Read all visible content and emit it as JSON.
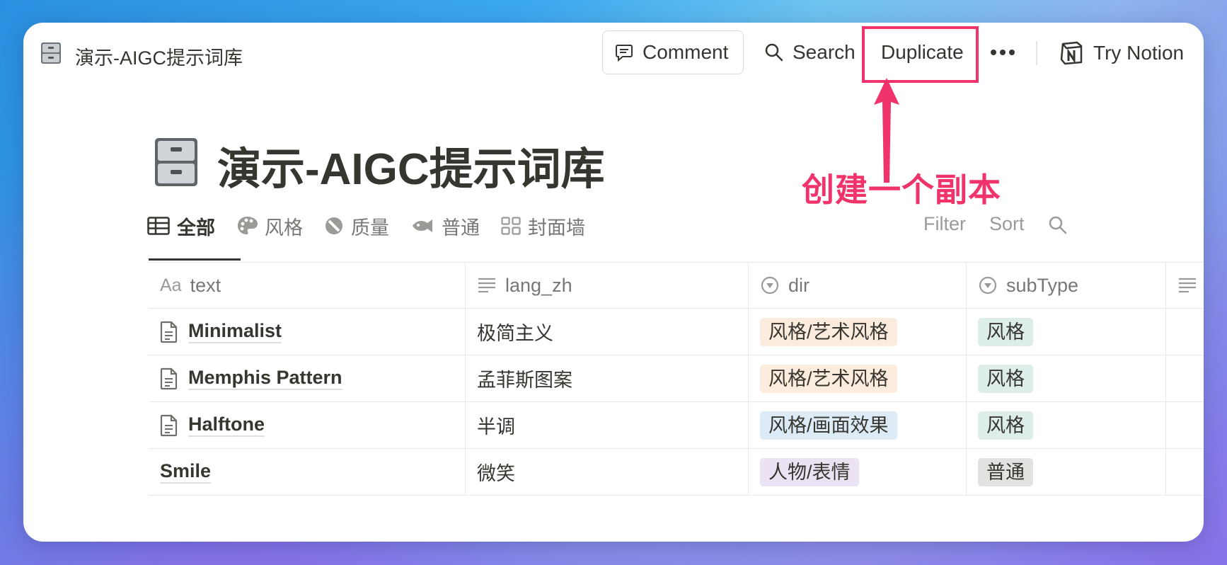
{
  "topbar": {
    "breadcrumb": "演示-AIGC提示词库",
    "comment_label": "Comment",
    "search_label": "Search",
    "duplicate_label": "Duplicate",
    "try_notion_label": "Try Notion"
  },
  "annotation": {
    "text": "创建一个副本",
    "color": "#f0336b"
  },
  "page": {
    "title": "演示-AIGC提示词库",
    "icon": "file-cabinet-icon"
  },
  "views": [
    {
      "label": "全部",
      "icon": "table-icon",
      "active": true
    },
    {
      "label": "风格",
      "icon": "palette-icon"
    },
    {
      "label": "质量",
      "icon": "quality-circle-icon"
    },
    {
      "label": "普通",
      "icon": "fish-icon"
    },
    {
      "label": "封面墙",
      "icon": "gallery-icon"
    }
  ],
  "toolbar": {
    "filter_label": "Filter",
    "sort_label": "Sort"
  },
  "table": {
    "columns": [
      {
        "label": "text",
        "icon": "Aa"
      },
      {
        "label": "lang_zh",
        "icon": "text-lines-icon"
      },
      {
        "label": "dir",
        "icon": "select-icon"
      },
      {
        "label": "subType",
        "icon": "select-icon"
      }
    ],
    "rows": [
      {
        "text": "Minimalist",
        "lang_zh": "极简主义",
        "dir": "风格/艺术风格",
        "subType": "风格"
      },
      {
        "text": "Memphis Pattern",
        "lang_zh": "孟菲斯图案",
        "dir": "风格/艺术风格",
        "subType": "风格"
      },
      {
        "text": "Halftone",
        "lang_zh": "半调",
        "dir": "风格/画面效果",
        "subType": "风格"
      },
      {
        "text": "Smile",
        "lang_zh": "微笑",
        "dir": "人物/表情",
        "subType": "普通"
      }
    ]
  }
}
